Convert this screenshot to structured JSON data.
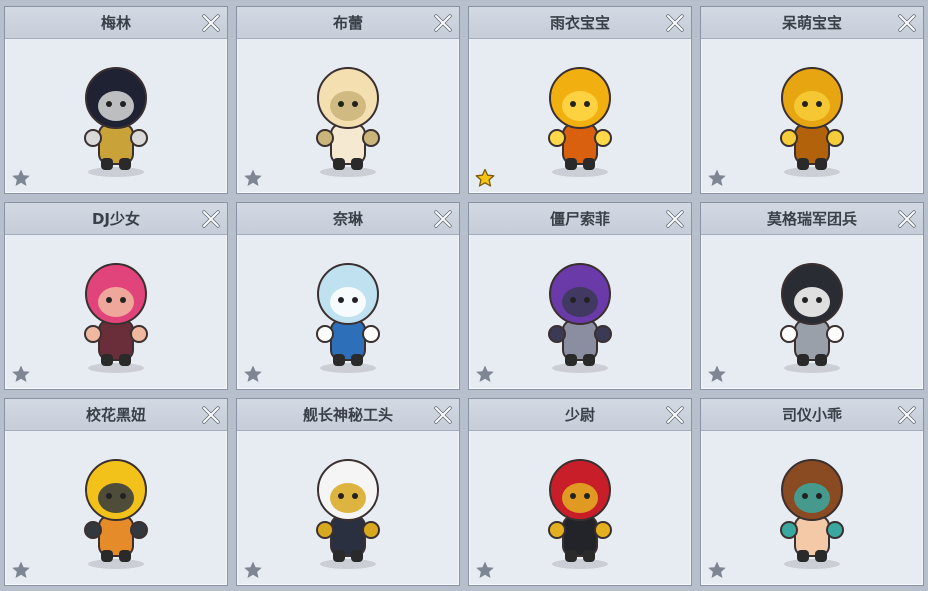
{
  "cards": [
    {
      "name": "梅林",
      "favorite": false,
      "icon": "wizard-pet-icon",
      "colors": [
        "#1f2233",
        "#c9a23a",
        "#d9d9d9"
      ]
    },
    {
      "name": "布蕾",
      "favorite": false,
      "icon": "blonde-girl-pet-icon",
      "colors": [
        "#f3dfb0",
        "#f6e9d2",
        "#c9b47a"
      ]
    },
    {
      "name": "雨衣宝宝",
      "favorite": true,
      "icon": "raincoat-baby-pet-icon",
      "colors": [
        "#f2b010",
        "#d9600e",
        "#ffd84a"
      ]
    },
    {
      "name": "呆萌宝宝",
      "favorite": false,
      "icon": "cute-baby-pet-icon",
      "colors": [
        "#e7a512",
        "#b3620c",
        "#f6cc3a"
      ]
    },
    {
      "name": "DJ少女",
      "favorite": false,
      "icon": "dj-girl-pet-icon",
      "colors": [
        "#e0447a",
        "#6a2d3a",
        "#f0b8a0"
      ]
    },
    {
      "name": "奈琳",
      "favorite": false,
      "icon": "nairin-pet-icon",
      "colors": [
        "#bfe1f0",
        "#2d6fb8",
        "#ffffff"
      ]
    },
    {
      "name": "僵尸索菲",
      "favorite": false,
      "icon": "zombie-sophie-pet-icon",
      "colors": [
        "#6a3aa8",
        "#8a8ea0",
        "#3a3a55"
      ]
    },
    {
      "name": "莫格瑞军团兵",
      "favorite": false,
      "icon": "robot-soldier-pet-icon",
      "colors": [
        "#2a2c33",
        "#9aa0aa",
        "#ffffff"
      ]
    },
    {
      "name": "校花黑妞",
      "favorite": false,
      "icon": "school-girl-pet-icon",
      "colors": [
        "#f2c21a",
        "#e58b2a",
        "#33383f"
      ]
    },
    {
      "name": "舰长神秘工头",
      "favorite": false,
      "icon": "captain-pet-icon",
      "colors": [
        "#f5f5f5",
        "#2a3040",
        "#d8a820"
      ]
    },
    {
      "name": "少尉",
      "favorite": false,
      "icon": "ensign-pet-icon",
      "colors": [
        "#c81e2a",
        "#222429",
        "#e5b020"
      ]
    },
    {
      "name": "司仪小乖",
      "favorite": false,
      "icon": "mc-boy-pet-icon",
      "colors": [
        "#8a4a22",
        "#f3c9a8",
        "#3aa8a0"
      ]
    }
  ],
  "ui_colors": {
    "star_empty": "#7e8593",
    "star_filled": "#f6c413",
    "close": "#ffffff"
  }
}
